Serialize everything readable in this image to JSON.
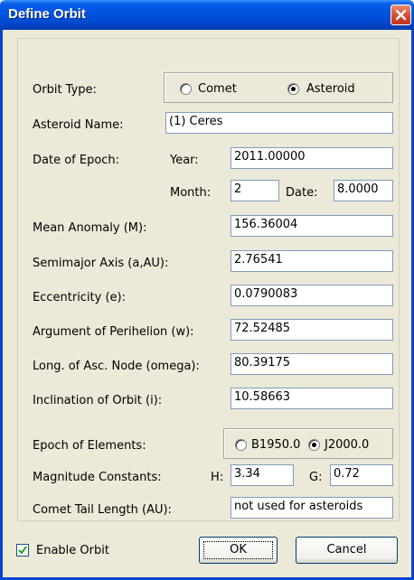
{
  "window": {
    "title": "Define Orbit"
  },
  "orbit_type": {
    "label": "Orbit Type:",
    "options": [
      "Comet",
      "Asteroid"
    ],
    "selected": "Asteroid"
  },
  "asteroid_name": {
    "label": "Asteroid Name:",
    "value": "(1) Ceres"
  },
  "date_of_epoch": {
    "label": "Date of Epoch:",
    "year_label": "Year:",
    "year_value": "2011.00000",
    "month_label": "Month:",
    "month_value": "2",
    "date_label": "Date:",
    "date_value": "8.0000"
  },
  "elements": [
    {
      "label": "Mean Anomaly (M):",
      "value": "156.36004"
    },
    {
      "label": "Semimajor Axis (a,AU):",
      "value": "2.76541"
    },
    {
      "label": "Eccentricity (e):",
      "value": "0.0790083"
    },
    {
      "label": "Argument of Perihelion (w):",
      "value": "72.52485"
    },
    {
      "label": "Long. of Asc. Node (omega):",
      "value": "80.39175"
    },
    {
      "label": "Inclination of Orbit (i):",
      "value": "10.58663"
    }
  ],
  "epoch_of_elements": {
    "label": "Epoch of Elements:",
    "options": [
      "B1950.0",
      "J2000.0"
    ],
    "selected": "J2000.0"
  },
  "magnitude": {
    "label": "Magnitude Constants:",
    "h_label": "H:",
    "h_value": "3.34",
    "g_label": "G:",
    "g_value": "0.72"
  },
  "tail_length": {
    "label": "Comet Tail Length (AU):",
    "value": "not used for asteroids"
  },
  "enable_orbit": {
    "label": "Enable Orbit",
    "checked": true
  },
  "buttons": {
    "ok": "OK",
    "cancel": "Cancel"
  }
}
